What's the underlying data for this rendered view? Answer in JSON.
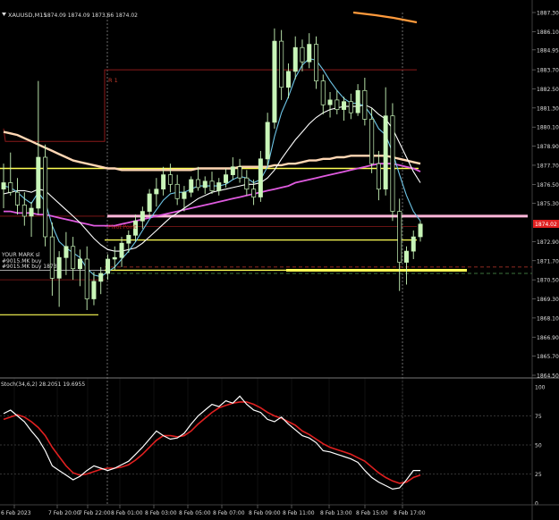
{
  "window": {
    "title": "XAUUSD,M15",
    "ohlc": "1874.09 1874.09 1873.66 1874.02",
    "colors": {
      "background": "#000000",
      "grid": "#2a2a2a",
      "candle_bull": "#c8f5b8",
      "ma_fast": "#6ec6e8",
      "ma_mid": "#ffffff",
      "ma_slow": "#ffd7b4",
      "ma_pink": "#e05be0",
      "ma_orange": "#ff9a3c",
      "yellow_level": "#ffff55",
      "pink_level": "#ffb6d9",
      "pivot": "#8b1a1a",
      "stoch_main": "#ffffff",
      "stoch_signal": "#e02020",
      "price_marker": "#e02020"
    }
  },
  "price_axis": {
    "labels": [
      "1887.30",
      "1886.10",
      "1884.95",
      "1883.70",
      "1882.50",
      "1881.30",
      "1880.10",
      "1878.90",
      "1877.70",
      "1876.50",
      "1875.30",
      "1874.02",
      "1872.90",
      "1871.70",
      "1870.50",
      "1869.30",
      "1868.10",
      "1866.90",
      "1865.70",
      "1864.50"
    ],
    "current_price": "1874.02"
  },
  "time_axis": {
    "labels": [
      "6 Feb 2023",
      "7 Feb 20:00",
      "7 Feb 22:00",
      "8 Feb 01:00",
      "8 Feb 03:00",
      "8 Feb 05:00",
      "8 Feb 07:00",
      "8 Feb 09:00",
      "8 Feb 11:00",
      "8 Feb 13:00",
      "8 Feb 15:00",
      "8 Feb 17:00"
    ]
  },
  "annotations": {
    "r1": "R 1",
    "pivot": "Pivot Point",
    "left_labels": [
      "YOUR MARK sl",
      "#9015.MK buy",
      "#9015.MK buy 1873"
    ]
  },
  "stochastic": {
    "label": "Stoch(34,6,2) 28.2051 19.6955",
    "axis_labels": [
      "100",
      "75",
      "50",
      "25",
      "0"
    ]
  },
  "chart_data": {
    "type": "candlestick",
    "symbol": "XAUUSD",
    "timeframe": "M15",
    "ylim": [
      1864.5,
      1887.3
    ],
    "levels": {
      "R1": 1883.7,
      "pivot": 1873.85,
      "pink": 1874.5,
      "yellow": [
        1877.5,
        1873.0,
        1871.3,
        1871.1
      ],
      "yellow_left_short": 1868.3
    },
    "candles": [
      [
        1876.2,
        1877.8,
        1875.0,
        1876.6
      ],
      [
        1876.6,
        1878.5,
        1875.8,
        1876.0
      ],
      [
        1876.0,
        1876.9,
        1874.6,
        1875.2
      ],
      [
        1875.2,
        1876.0,
        1873.9,
        1874.5
      ],
      [
        1874.5,
        1875.4,
        1873.2,
        1875.0
      ],
      [
        1875.0,
        1883.0,
        1874.6,
        1878.2
      ],
      [
        1878.2,
        1879.0,
        1872.6,
        1873.2
      ],
      [
        1873.2,
        1874.1,
        1869.5,
        1870.6
      ],
      [
        1870.6,
        1872.3,
        1868.8,
        1871.9
      ],
      [
        1871.9,
        1873.5,
        1870.8,
        1872.6
      ],
      [
        1872.6,
        1873.2,
        1870.5,
        1871.2
      ],
      [
        1871.2,
        1872.4,
        1870.1,
        1871.8
      ],
      [
        1871.8,
        1872.6,
        1868.6,
        1869.3
      ],
      [
        1869.3,
        1871.0,
        1868.9,
        1870.4
      ],
      [
        1870.4,
        1871.3,
        1869.6,
        1870.9
      ],
      [
        1870.9,
        1872.1,
        1870.5,
        1871.8
      ],
      [
        1871.8,
        1872.6,
        1871.1,
        1871.9
      ],
      [
        1871.9,
        1873.2,
        1871.3,
        1872.8
      ],
      [
        1872.8,
        1873.6,
        1872.2,
        1873.3
      ],
      [
        1873.3,
        1874.6,
        1872.9,
        1874.2
      ],
      [
        1874.2,
        1875.1,
        1873.7,
        1874.8
      ],
      [
        1874.8,
        1876.2,
        1874.4,
        1875.9
      ],
      [
        1875.9,
        1876.9,
        1875.1,
        1876.2
      ],
      [
        1876.2,
        1877.6,
        1875.8,
        1877.1
      ],
      [
        1877.1,
        1877.8,
        1876.0,
        1876.5
      ],
      [
        1876.5,
        1877.1,
        1875.2,
        1875.6
      ],
      [
        1875.6,
        1876.4,
        1874.8,
        1876.0
      ],
      [
        1876.0,
        1877.0,
        1875.7,
        1876.8
      ],
      [
        1876.8,
        1877.6,
        1876.1,
        1876.3
      ],
      [
        1876.3,
        1877.0,
        1875.9,
        1876.7
      ],
      [
        1876.7,
        1877.3,
        1875.9,
        1876.1
      ],
      [
        1876.1,
        1876.9,
        1875.8,
        1876.6
      ],
      [
        1876.6,
        1877.5,
        1876.3,
        1877.1
      ],
      [
        1877.1,
        1878.2,
        1876.8,
        1877.6
      ],
      [
        1877.6,
        1878.1,
        1876.6,
        1876.9
      ],
      [
        1876.9,
        1877.4,
        1875.8,
        1876.2
      ],
      [
        1876.2,
        1876.8,
        1875.2,
        1875.7
      ],
      [
        1875.7,
        1878.6,
        1875.4,
        1878.1
      ],
      [
        1878.1,
        1881.0,
        1877.7,
        1880.4
      ],
      [
        1880.4,
        1886.3,
        1880.0,
        1885.5
      ],
      [
        1885.5,
        1886.2,
        1881.8,
        1882.6
      ],
      [
        1882.6,
        1884.1,
        1881.9,
        1883.6
      ],
      [
        1883.6,
        1885.8,
        1883.1,
        1885.1
      ],
      [
        1885.1,
        1885.6,
        1883.6,
        1884.2
      ],
      [
        1884.2,
        1886.0,
        1883.8,
        1885.3
      ],
      [
        1885.3,
        1885.8,
        1882.5,
        1883.0
      ],
      [
        1883.0,
        1883.4,
        1880.9,
        1881.5
      ],
      [
        1881.5,
        1882.3,
        1880.7,
        1881.8
      ],
      [
        1881.8,
        1882.4,
        1880.9,
        1881.2
      ],
      [
        1881.2,
        1882.0,
        1880.5,
        1881.7
      ],
      [
        1881.7,
        1882.2,
        1880.6,
        1881.0
      ],
      [
        1881.0,
        1882.8,
        1880.8,
        1882.4
      ],
      [
        1882.4,
        1883.2,
        1880.2,
        1880.6
      ],
      [
        1880.6,
        1881.3,
        1877.2,
        1877.8
      ],
      [
        1877.8,
        1878.6,
        1875.5,
        1876.2
      ],
      [
        1876.2,
        1882.6,
        1875.8,
        1880.8
      ],
      [
        1880.8,
        1881.6,
        1874.2,
        1874.8
      ],
      [
        1874.8,
        1875.6,
        1869.8,
        1871.6
      ],
      [
        1871.6,
        1872.6,
        1870.2,
        1872.3
      ],
      [
        1872.3,
        1873.6,
        1871.8,
        1873.2
      ],
      [
        1873.2,
        1874.2,
        1872.9,
        1874.0
      ]
    ],
    "moving_averages": [
      {
        "color": "#ffd7b4",
        "values": [
          1879.8,
          1879.7,
          1879.6,
          1879.4,
          1879.2,
          1879.0,
          1878.8,
          1878.6,
          1878.4,
          1878.2,
          1878.0,
          1877.9,
          1877.8,
          1877.7,
          1877.6,
          1877.5,
          1877.5,
          1877.4,
          1877.4,
          1877.4,
          1877.4,
          1877.4,
          1877.4,
          1877.4,
          1877.4,
          1877.4,
          1877.4,
          1877.4,
          1877.5,
          1877.5,
          1877.5,
          1877.5,
          1877.5,
          1877.5,
          1877.6,
          1877.6,
          1877.6,
          1877.6,
          1877.6,
          1877.7,
          1877.7,
          1877.8,
          1877.8,
          1877.9,
          1878.0,
          1878.0,
          1878.1,
          1878.1,
          1878.2,
          1878.2,
          1878.3,
          1878.3,
          1878.3,
          1878.3,
          1878.3,
          1878.3,
          1878.2,
          1878.1,
          1878.0,
          1877.9,
          1877.8
        ]
      },
      {
        "color": "#e05be0",
        "values": [
          1874.8,
          1874.8,
          1874.7,
          1874.7,
          1874.7,
          1874.6,
          1874.6,
          1874.5,
          1874.4,
          1874.3,
          1874.2,
          1874.1,
          1874.0,
          1873.9,
          1873.9,
          1873.9,
          1873.9,
          1874.0,
          1874.1,
          1874.2,
          1874.3,
          1874.4,
          1874.5,
          1874.6,
          1874.7,
          1874.8,
          1874.9,
          1875.0,
          1875.1,
          1875.2,
          1875.3,
          1875.4,
          1875.5,
          1875.6,
          1875.7,
          1875.8,
          1875.9,
          1876.0,
          1876.1,
          1876.2,
          1876.3,
          1876.4,
          1876.6,
          1876.7,
          1876.8,
          1876.9,
          1877.0,
          1877.1,
          1877.2,
          1877.3,
          1877.4,
          1877.5,
          1877.6,
          1877.7,
          1877.8,
          1877.8,
          1877.8,
          1877.7,
          1877.6,
          1877.5,
          1877.3
        ]
      },
      {
        "color": "#ffffff",
        "values": [
          1875.9,
          1876.0,
          1876.1,
          1876.1,
          1876.0,
          1876.2,
          1876.1,
          1875.7,
          1875.3,
          1874.9,
          1874.5,
          1874.1,
          1873.6,
          1873.1,
          1872.7,
          1872.4,
          1872.3,
          1872.3,
          1872.4,
          1872.5,
          1872.8,
          1873.2,
          1873.6,
          1874.0,
          1874.4,
          1874.7,
          1875.0,
          1875.3,
          1875.6,
          1875.8,
          1876.0,
          1876.1,
          1876.2,
          1876.3,
          1876.4,
          1876.5,
          1876.5,
          1876.6,
          1876.9,
          1877.4,
          1878.1,
          1878.7,
          1879.3,
          1879.8,
          1880.3,
          1880.7,
          1881.0,
          1881.2,
          1881.3,
          1881.4,
          1881.4,
          1881.4,
          1881.5,
          1881.3,
          1880.9,
          1880.6,
          1880.0,
          1879.1,
          1878.2,
          1877.3,
          1876.6
        ]
      },
      {
        "color": "#6ec6e8",
        "values": [
          1876.4,
          1876.3,
          1876.0,
          1875.6,
          1875.3,
          1876.0,
          1875.4,
          1873.9,
          1872.9,
          1872.5,
          1872.2,
          1871.9,
          1871.2,
          1870.8,
          1870.7,
          1871.0,
          1871.3,
          1871.8,
          1872.3,
          1872.9,
          1873.6,
          1874.3,
          1874.9,
          1875.5,
          1875.9,
          1876.0,
          1876.0,
          1876.2,
          1876.4,
          1876.4,
          1876.4,
          1876.4,
          1876.5,
          1876.8,
          1877.0,
          1876.9,
          1876.6,
          1876.8,
          1877.6,
          1879.5,
          1881.0,
          1882.0,
          1883.2,
          1884.0,
          1884.4,
          1884.3,
          1883.7,
          1883.0,
          1882.4,
          1881.9,
          1881.6,
          1881.6,
          1881.4,
          1880.8,
          1880.0,
          1879.6,
          1878.5,
          1877.1,
          1875.8,
          1874.8,
          1874.2
        ]
      }
    ],
    "stoch_main": [
      77,
      80,
      75,
      70,
      62,
      55,
      45,
      32,
      28,
      24,
      20,
      23,
      28,
      32,
      30,
      28,
      30,
      33,
      36,
      42,
      48,
      55,
      62,
      58,
      55,
      56,
      60,
      68,
      75,
      80,
      85,
      83,
      88,
      86,
      92,
      85,
      80,
      78,
      72,
      70,
      74,
      68,
      63,
      58,
      56,
      52,
      45,
      44,
      42,
      40,
      38,
      35,
      28,
      22,
      18,
      15,
      12,
      13,
      20,
      28,
      28
    ],
    "stoch_signal": [
      72,
      74,
      76,
      74,
      70,
      65,
      58,
      48,
      40,
      32,
      26,
      24,
      25,
      27,
      29,
      30,
      30,
      31,
      33,
      37,
      42,
      48,
      54,
      58,
      58,
      57,
      58,
      62,
      68,
      73,
      78,
      82,
      84,
      86,
      87,
      87,
      85,
      82,
      78,
      75,
      73,
      70,
      67,
      62,
      59,
      55,
      51,
      48,
      46,
      44,
      42,
      39,
      36,
      31,
      26,
      22,
      19,
      17,
      18,
      22,
      24
    ]
  }
}
